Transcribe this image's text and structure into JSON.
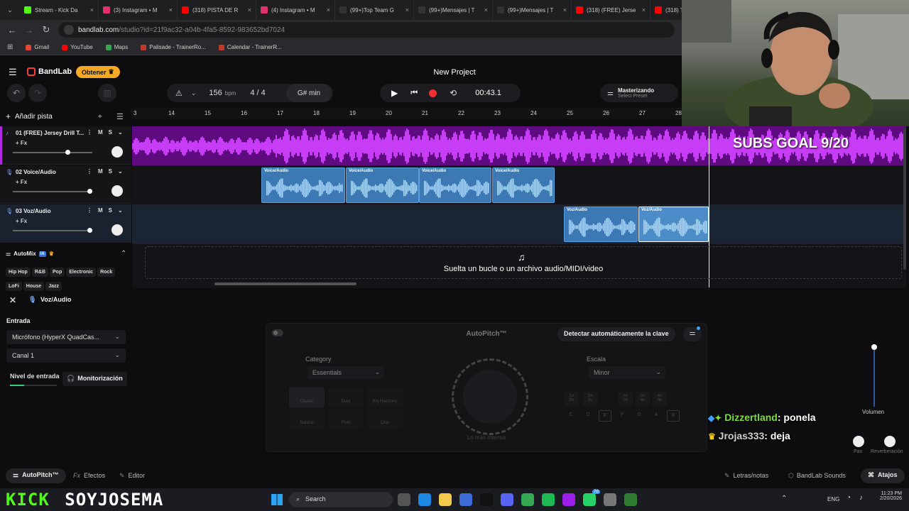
{
  "browser": {
    "tabs": [
      {
        "title": "Stream - Kick Da",
        "color": "#53fc18"
      },
      {
        "title": "(3) Instagram • M",
        "color": "#e1306c"
      },
      {
        "title": "(318) PISTA DE R",
        "color": "#ff0000"
      },
      {
        "title": "(4) Instagram • M",
        "color": "#e1306c"
      },
      {
        "title": "(99+)Top Team G",
        "color": "#333333"
      },
      {
        "title": "(99+)Mensajes | T",
        "color": "#333333"
      },
      {
        "title": "(99+)Mensajes | T",
        "color": "#333333"
      },
      {
        "title": "(318) (FREE) Jerse",
        "color": "#ff0000"
      },
      {
        "title": "(318) T",
        "color": "#ff0000"
      }
    ],
    "url_host": "bandlab.com",
    "url_path": "/studio?id=21f9ac32-a04b-4fa5-8592-983652bd7024",
    "bookmarks": [
      {
        "label": "Gmail",
        "color": "#ea4335"
      },
      {
        "label": "YouTube",
        "color": "#ff0000"
      },
      {
        "label": "Maps",
        "color": "#34a853"
      },
      {
        "label": "Palisade - TrainerRo...",
        "color": "#c0392b"
      },
      {
        "label": "Calendar - TrainerR...",
        "color": "#c0392b"
      }
    ]
  },
  "header": {
    "brand": "BandLab",
    "obtener": "Obtener",
    "project_title": "New Project"
  },
  "transport": {
    "bpm_value": "156",
    "bpm_unit": "bpm",
    "time_sig": "4 / 4",
    "key": "G# min",
    "time": "00:43.1",
    "master_title": "Masterizando",
    "master_sub": "Select Preset"
  },
  "tracks_panel": {
    "add_track": "Añadir pista",
    "tracks": [
      {
        "name": "01  (FREE) Jersey Drill T...",
        "fx": "+ Fx",
        "mute": "M",
        "solo": "S",
        "color": "#b027e6",
        "volume": 0.7
      },
      {
        "name": "02  Voice/Audio",
        "fx": "+ Fx",
        "mute": "M",
        "solo": "S",
        "color": "#3c79b4",
        "volume": 0.97
      },
      {
        "name": "03  Voz/Audio",
        "fx": "+ Fx",
        "mute": "M",
        "solo": "S",
        "color": "#3c79b4",
        "volume": 0.97
      }
    ]
  },
  "ruler": {
    "ticks": [
      "3",
      "14",
      "15",
      "16",
      "17",
      "18",
      "19",
      "20",
      "21",
      "22",
      "23",
      "24",
      "25",
      "26",
      "27",
      "28"
    ]
  },
  "clips": {
    "voice_label": "Voice/Audio",
    "voz_label": "Voz/Audio",
    "subs_goal": "SUBS GOAL 9/20",
    "drop_text": "Suelta un bucle o un archivo audio/MIDI/video"
  },
  "automix": {
    "title": "AutoMix",
    "ia": "IA",
    "genres": [
      "Hip Hop",
      "R&B",
      "Pop",
      "Electronic",
      "Rock",
      "LoFi",
      "House",
      "Jazz"
    ]
  },
  "selected": {
    "track": "Voz/Audio"
  },
  "input": {
    "entrada": "Entrada",
    "device": "Micrófono (HyperX QuadCas...",
    "channel": "Canal 1",
    "level_label": "Nivel de entrada",
    "monitor": "Monitorización"
  },
  "autopitch": {
    "title": "AutoPitch™",
    "detect": "Detectar automáticamente la clave",
    "category_label": "Category",
    "category_value": "Essentials",
    "scale_label": "Escala",
    "scale_value": "Minor",
    "presets": [
      "Classic",
      "Duet",
      "Big Harmony",
      "Natural",
      "Fluid",
      "Chip"
    ],
    "notes_top": [
      "C#\nDb",
      "D#\nEb",
      "F#\nGb",
      "G#\nAb",
      "A#\nBb"
    ],
    "notes_bottom": [
      "C",
      "D",
      "E",
      "F",
      "G",
      "A",
      "B"
    ],
    "intensity": "Lo más intenso"
  },
  "right_mixer": {
    "volumen": "Volumen",
    "pan": "Pan",
    "reverb": "Reverberación"
  },
  "chat": [
    {
      "user": "Dizzertland",
      "msg": ": ponela"
    },
    {
      "user": "Jrojas333",
      "msg": ": deja"
    }
  ],
  "bottom_tabs": {
    "autopitch": "AutoPitch™",
    "efectos": "Efectos",
    "editor": "Editor",
    "letras": "Letras/notas",
    "sounds": "BandLab Sounds",
    "atajos": "Atajos"
  },
  "stream_overlay": {
    "kick": "KICK",
    "name": "SOYJOSEMA"
  },
  "taskbar": {
    "search": "Search",
    "lang": "ENG",
    "time": "11:23 PM",
    "date": "2/20/2026",
    "badge": "70"
  }
}
